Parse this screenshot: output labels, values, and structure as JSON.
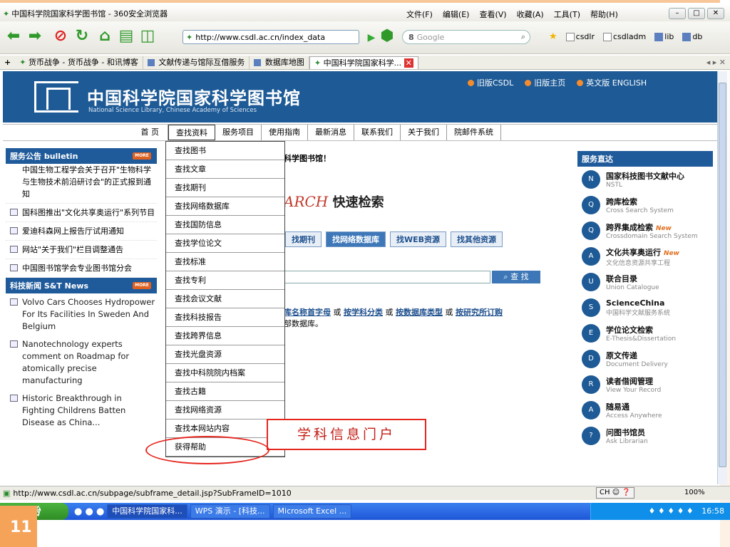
{
  "slide_number": "11",
  "browser": {
    "title": "中国科学院国家科学图书馆 - 360安全浏览器",
    "menus": [
      "文件(F)",
      "编辑(E)",
      "查看(V)",
      "收藏(A)",
      "工具(T)",
      "帮助(H)"
    ],
    "address": "http://www.csdl.ac.cn/index_data",
    "search_placeholder": "Google",
    "bookmarks": [
      "csdlr",
      "csdladm",
      "lib",
      "db"
    ]
  },
  "tabs": [
    {
      "label": "货币战争 - 货币战争 - 和讯博客"
    },
    {
      "label": "文献传递与馆际互借服务"
    },
    {
      "label": "数据库地图"
    },
    {
      "label": "中国科学院国家科学..."
    }
  ],
  "site": {
    "title": "中国科学院国家科学图书馆",
    "subtitle": "National Science Library, Chinese Academy of Sciences",
    "top_links": [
      "旧版CSDL",
      "旧版主页",
      "英文版 ENGLISH"
    ]
  },
  "nav": {
    "home": "首 页",
    "items": [
      "查找资料",
      "服务项目",
      "使用指南",
      "最新消息",
      "联系我们",
      "关于我们",
      "院邮件系统"
    ]
  },
  "bulletin": {
    "title": "服务公告 bulletin",
    "more": "MORE",
    "items": [
      "中国生物工程学会关于召开\"生物科学与生物技术前沿研讨会\"的正式报到通知",
      "国科图推出\"文化共享奥运行\"系列节目",
      "爱迪科森网上报告厅试用通知",
      "网站\"关于我们\"栏目调整通告",
      "中国图书馆学会专业图书馆分会"
    ]
  },
  "news": {
    "title": "科技新闻 S&T News",
    "more": "MORE",
    "items": [
      "Volvo Cars Chooses Hydropower For Its Facilities In Sweden And Belgium",
      "Nanotechnology experts comment on Roadmap for atomically precise manufacturing",
      "Historic Breakthrough in Fighting Childrens Batten Disease as China..."
    ]
  },
  "center": {
    "welcome": "科学图书馆！",
    "qs_title_en": "ARCH",
    "qs_title_cn": "快速检索",
    "tabs": [
      "找期刊",
      "找网络数据库",
      "找WEB资源",
      "找其他资源"
    ],
    "search_button": "查 找",
    "browse_links": [
      "库名称首字母",
      "按学科分类",
      "按数据库类型",
      "按研究所订购"
    ],
    "browse_or": "或",
    "browse_suffix": "部数据库。"
  },
  "dropdown": [
    "查找图书",
    "查找文章",
    "查找期刊",
    "查找网络数据库",
    "查找国防信息",
    "查找学位论文",
    "查找标准",
    "查找专利",
    "查找会议文献",
    "查找科技报告",
    "查找跨界信息",
    "查找光盘资源",
    "查找中科院院内档案",
    "查找古籍",
    "查找网络资源",
    "查找本网站内容",
    "获得帮助"
  ],
  "callout": "学科信息门户",
  "services": {
    "title": "服务直达",
    "items": [
      {
        "name": "国家科技图书文献中心",
        "sub": "NSTL",
        "icon": "N",
        "new": ""
      },
      {
        "name": "跨库检索",
        "sub": "Cross Search System",
        "icon": "Q",
        "new": ""
      },
      {
        "name": "跨界集成检索",
        "sub": "Crossdomain Search System",
        "icon": "Q",
        "new": "New"
      },
      {
        "name": "文化共享奥运行",
        "sub": "文化信息资源共享工程",
        "icon": "A",
        "new": "New"
      },
      {
        "name": "联合目录",
        "sub": "Union Catalogue",
        "icon": "U",
        "new": ""
      },
      {
        "name": "ScienceChina",
        "sub": "中国科学文献服务系统",
        "icon": "S",
        "new": ""
      },
      {
        "name": "学位论文检索",
        "sub": "E-Thesis&Dissertation",
        "icon": "E",
        "new": ""
      },
      {
        "name": "原文传递",
        "sub": "Document Delivery",
        "icon": "D",
        "new": ""
      },
      {
        "name": "读者借阅管理",
        "sub": "View Your Record",
        "icon": "R",
        "new": ""
      },
      {
        "name": "随易通",
        "sub": "Access Anywhere",
        "icon": "A",
        "new": ""
      },
      {
        "name": "问图书馆员",
        "sub": "Ask Librarian",
        "icon": "?",
        "new": ""
      }
    ]
  },
  "status": {
    "url": "http://www.csdl.ac.cn/subpage/subframe_detail.jsp?SubFrameID=1010",
    "ime": "CH",
    "zoom": "100%"
  },
  "taskbar": {
    "start": "开始",
    "buttons": [
      "中国科学院国家科...",
      "WPS 演示 - [科技...",
      "Microsoft Excel ..."
    ],
    "clock": "16:58"
  }
}
